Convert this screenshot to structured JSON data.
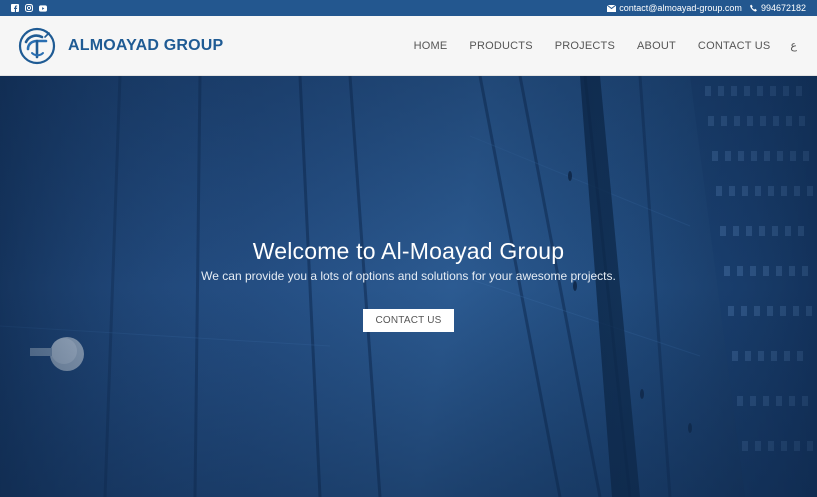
{
  "topbar": {
    "social": [
      {
        "icon": "facebook-icon"
      },
      {
        "icon": "instagram-icon"
      },
      {
        "icon": "youtube-icon"
      }
    ],
    "email": "contact@almoayad-group.com",
    "phone": "994672182"
  },
  "header": {
    "brand": "ALMOAYAD GROUP",
    "nav": [
      "HOME",
      "PRODUCTS",
      "PROJECTS",
      "ABOUT",
      "CONTACT US"
    ],
    "lang": "ع"
  },
  "hero": {
    "title": "Welcome to Al-Moayad Group",
    "subtitle": "We can provide you a lots of options and solutions for your awesome projects.",
    "button": "CONTACT US"
  },
  "colors": {
    "topbar": "#23578f",
    "brand": "#1f5b94",
    "hero": "#254f84"
  }
}
